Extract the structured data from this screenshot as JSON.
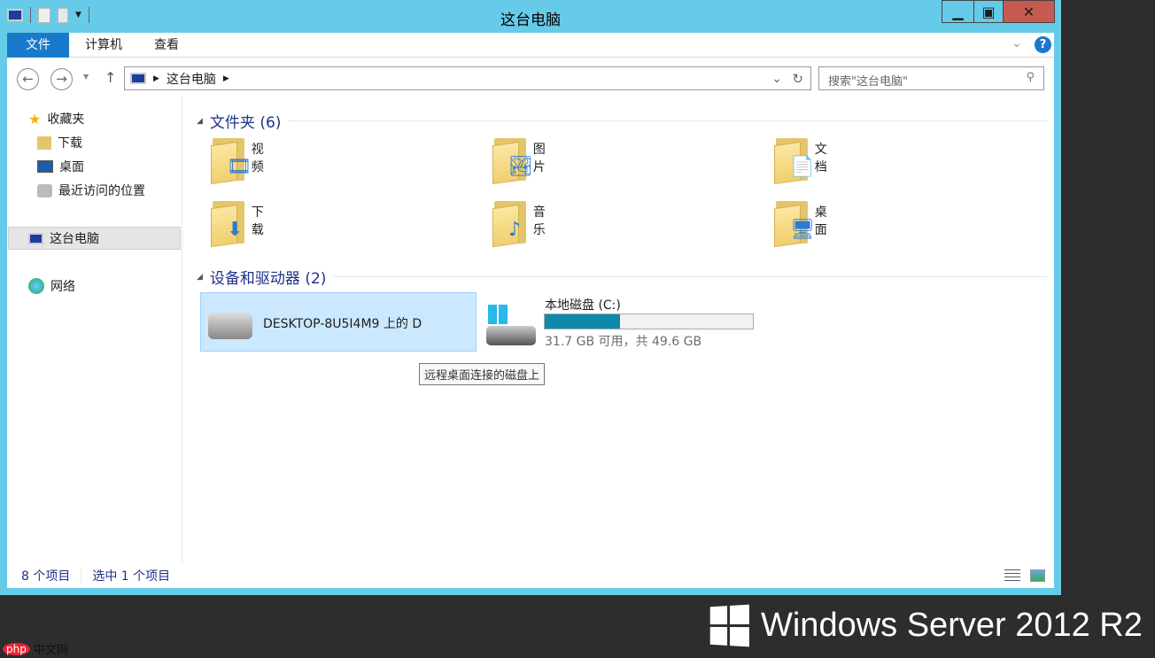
{
  "window": {
    "title": "这台电脑",
    "minimize": "▁",
    "maximize": "□",
    "close": "X"
  },
  "ribbon": {
    "tabs": [
      "文件",
      "计算机",
      "查看"
    ],
    "help": "?"
  },
  "address": {
    "path": "这台电脑",
    "search_placeholder": "搜索\"这台电脑\""
  },
  "nav": {
    "favorites": "收藏夹",
    "items": [
      "下载",
      "桌面",
      "最近访问的位置"
    ],
    "this_pc": "这台电脑",
    "network": "网络"
  },
  "folders": {
    "header": "文件夹 (6)",
    "items": [
      {
        "label": "视频",
        "icon": "film"
      },
      {
        "label": "图片",
        "icon": "picture"
      },
      {
        "label": "文档",
        "icon": "document"
      },
      {
        "label": "下载",
        "icon": "down-arrow"
      },
      {
        "label": "音乐",
        "icon": "music-note"
      },
      {
        "label": "桌面",
        "icon": "desktop"
      }
    ]
  },
  "devices": {
    "header": "设备和驱动器 (2)",
    "remote": "DESKTOP-8U5I4M9 上的 D",
    "local": {
      "label": "本地磁盘 (C:)",
      "free": "31.7 GB 可用，共 49.6 GB",
      "used_fraction": 0.36,
      "bar_color": "#0e89a7"
    }
  },
  "tooltip": "远程桌面连接的磁盘上",
  "status": {
    "count": "8 个项目",
    "selected": "选中 1 个项目"
  },
  "brand": {
    "text": "Windows Server 2012 R2",
    "watermark": "php中文网"
  },
  "colors": {
    "titlebar": "#66cbe9",
    "file_tab": "#1979ca",
    "close": "#c75a50"
  }
}
